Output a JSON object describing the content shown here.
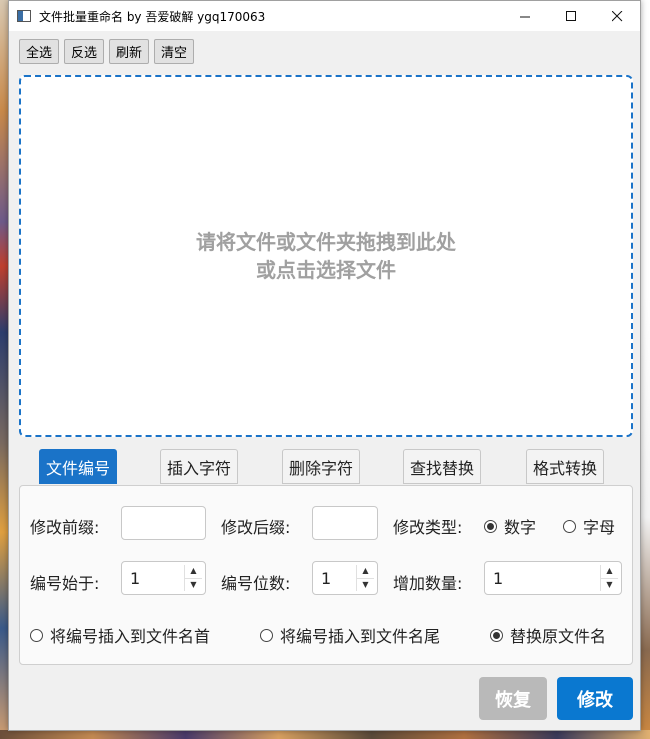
{
  "window": {
    "title": "文件批量重命名 by 吾爱破解 ygq170063"
  },
  "toolbar": {
    "select_all": "全选",
    "invert": "反选",
    "refresh": "刷新",
    "clear": "清空"
  },
  "dropzone": {
    "line1": "请将文件或文件夹拖拽到此处",
    "line2": "或点击选择文件"
  },
  "tabs": [
    {
      "label": "文件编号",
      "active": true
    },
    {
      "label": "插入字符",
      "active": false
    },
    {
      "label": "删除字符",
      "active": false
    },
    {
      "label": "查找替换",
      "active": false
    },
    {
      "label": "格式转换",
      "active": false
    }
  ],
  "form": {
    "prefix_label": "修改前缀:",
    "prefix_value": "",
    "suffix_label": "修改后缀:",
    "suffix_value": "",
    "type_label": "修改类型:",
    "type_digit": "数字",
    "type_letter": "字母",
    "start_label": "编号始于:",
    "start_value": "1",
    "digits_label": "编号位数:",
    "digits_value": "1",
    "increment_label": "增加数量:",
    "increment_value": "1",
    "pos_head": "将编号插入到文件名首",
    "pos_tail": "将编号插入到文件名尾",
    "pos_replace": "替换原文件名"
  },
  "actions": {
    "restore": "恢复",
    "modify": "修改"
  },
  "colors": {
    "accent": "#1a73c8",
    "restore_disabled": "#b9b9b9",
    "modify": "#0a78d0"
  }
}
